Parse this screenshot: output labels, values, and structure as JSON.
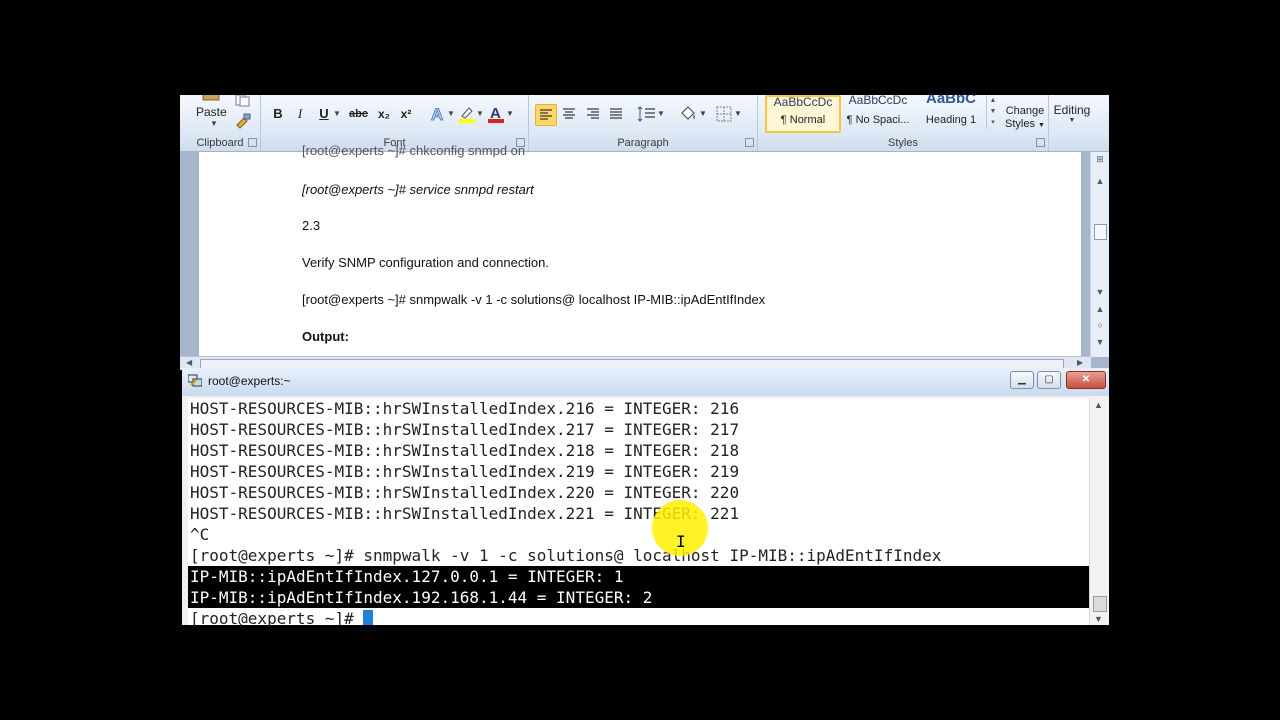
{
  "word": {
    "ribbon": {
      "clipboard": {
        "label": "Clipboard",
        "paste_label": "Paste"
      },
      "font": {
        "label": "Font",
        "bold": "B",
        "italic": "I",
        "underline": "U",
        "strike": "abc",
        "subscript": "x₂",
        "superscript": "x²"
      },
      "paragraph": {
        "label": "Paragraph"
      },
      "styles": {
        "label": "Styles",
        "items": [
          {
            "preview": "AaBbCcDc",
            "name": "¶ Normal"
          },
          {
            "preview": "AaBbCcDc",
            "name": "¶ No Spaci..."
          },
          {
            "preview": "AaBbC",
            "name": "Heading 1"
          }
        ],
        "change_styles_line1": "Change",
        "change_styles_line2": "Styles"
      },
      "editing": {
        "label": "Editing"
      }
    },
    "document": {
      "cut_line": "[root@experts ~]# chkconfig snmpd on",
      "lines": [
        "[root@experts ~]# service snmpd restart",
        "2.3",
        "Verify SNMP configuration and connection.",
        "[root@experts ~]#  snmpwalk -v 1 -c solutions@  localhost  IP-MIB::ipAdEntIfIndex",
        "Output:"
      ]
    }
  },
  "putty": {
    "title": "root@experts:~",
    "terminal_lines": [
      "HOST-RESOURCES-MIB::hrSWInstalledIndex.216 = INTEGER: 216",
      "HOST-RESOURCES-MIB::hrSWInstalledIndex.217 = INTEGER: 217",
      "HOST-RESOURCES-MIB::hrSWInstalledIndex.218 = INTEGER: 218",
      "HOST-RESOURCES-MIB::hrSWInstalledIndex.219 = INTEGER: 219",
      "HOST-RESOURCES-MIB::hrSWInstalledIndex.220 = INTEGER: 220",
      "HOST-RESOURCES-MIB::hrSWInstalledIndex.221 = INTEGER: 221",
      "^C",
      "[root@experts ~]# snmpwalk -v 1 -c solutions@ localhost IP-MIB::ipAdEntIfIndex"
    ],
    "selected_lines": [
      "IP-MIB::ipAdEntIfIndex.127.0.0.1 = INTEGER: 1",
      "IP-MIB::ipAdEntIfIndex.192.168.1.44 = INTEGER: 2"
    ],
    "prompt": "[root@experts ~]# "
  },
  "colors": {
    "selection_bg": "#000000",
    "cursor": "#1e7fe0",
    "mouse_highlight": "#fff000",
    "ribbon_bg": "#dde8f5"
  },
  "icons": {
    "paste": "clipboard-paste-icon",
    "copy": "copy-icon",
    "format_painter": "format-painter-icon",
    "putty": "putty-icon"
  }
}
